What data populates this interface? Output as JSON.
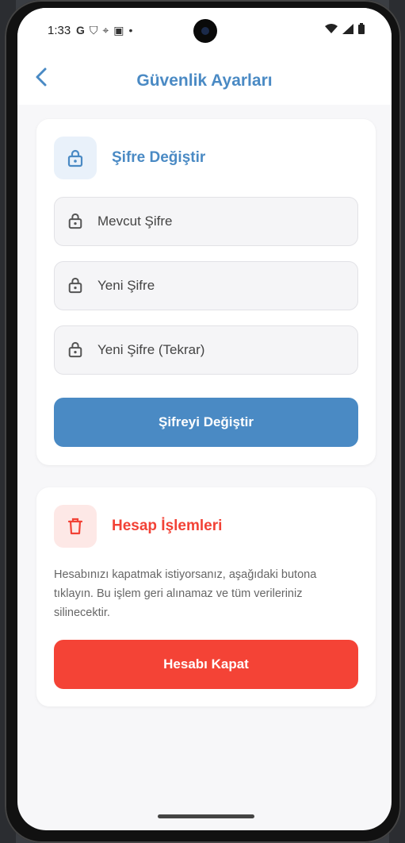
{
  "status_bar": {
    "time": "1:33",
    "left_icons": [
      "google-icon",
      "shield-icon",
      "location-icon",
      "photo-icon",
      "dot-icon"
    ],
    "right_icons": [
      "wifi-icon",
      "signal-icon",
      "battery-icon"
    ]
  },
  "app_bar": {
    "title": "Güvenlik Ayarları",
    "back_icon": "chevron-left-icon"
  },
  "password_section": {
    "title": "Şifre Değiştir",
    "icon": "lock-icon",
    "fields": [
      {
        "placeholder": "Mevcut Şifre",
        "icon": "lock-icon"
      },
      {
        "placeholder": "Yeni Şifre",
        "icon": "lock-icon"
      },
      {
        "placeholder": "Yeni Şifre (Tekrar)",
        "icon": "lock-icon"
      }
    ],
    "button_label": "Şifreyi Değiştir"
  },
  "account_section": {
    "title": "Hesap İşlemleri",
    "icon": "trash-icon",
    "description": "Hesabınızı kapatmak istiyorsanız, aşağıdaki butona tıklayın. Bu işlem geri alınamaz ve tüm verileriniz silinecektir.",
    "button_label": "Hesabı Kapat"
  },
  "colors": {
    "primary": "#4a8ac4",
    "danger": "#f44336",
    "background": "#f7f7f9"
  }
}
